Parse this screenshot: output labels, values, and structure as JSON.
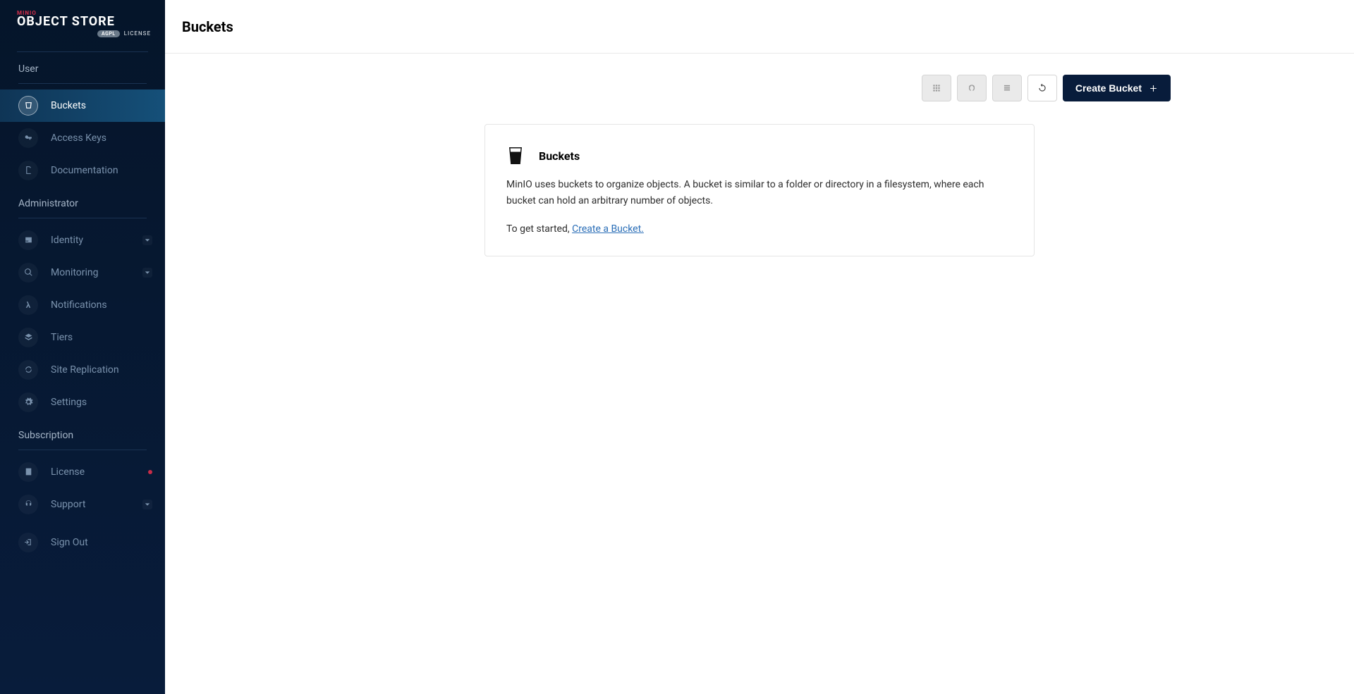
{
  "brand": {
    "minio": "MINIO",
    "object_store": "OBJECT STORE",
    "license_badge": "AGPL",
    "license_text": "LICENSE"
  },
  "sidebar": {
    "sections": {
      "user": "User",
      "administrator": "Administrator",
      "subscription": "Subscription"
    },
    "items": {
      "buckets": "Buckets",
      "access_keys": "Access Keys",
      "documentation": "Documentation",
      "identity": "Identity",
      "monitoring": "Monitoring",
      "notifications": "Notifications",
      "tiers": "Tiers",
      "site_replication": "Site Replication",
      "settings": "Settings",
      "license": "License",
      "support": "Support",
      "sign_out": "Sign Out"
    }
  },
  "header": {
    "title": "Buckets"
  },
  "toolbar": {
    "create_bucket_label": "Create Bucket"
  },
  "empty_state": {
    "title": "Buckets",
    "description": "MinIO uses buckets to organize objects. A bucket is similar to a folder or directory in a filesystem, where each bucket can hold an arbitrary number of objects.",
    "cta_prefix": "To get started, ",
    "cta_link": "Create a Bucket."
  }
}
